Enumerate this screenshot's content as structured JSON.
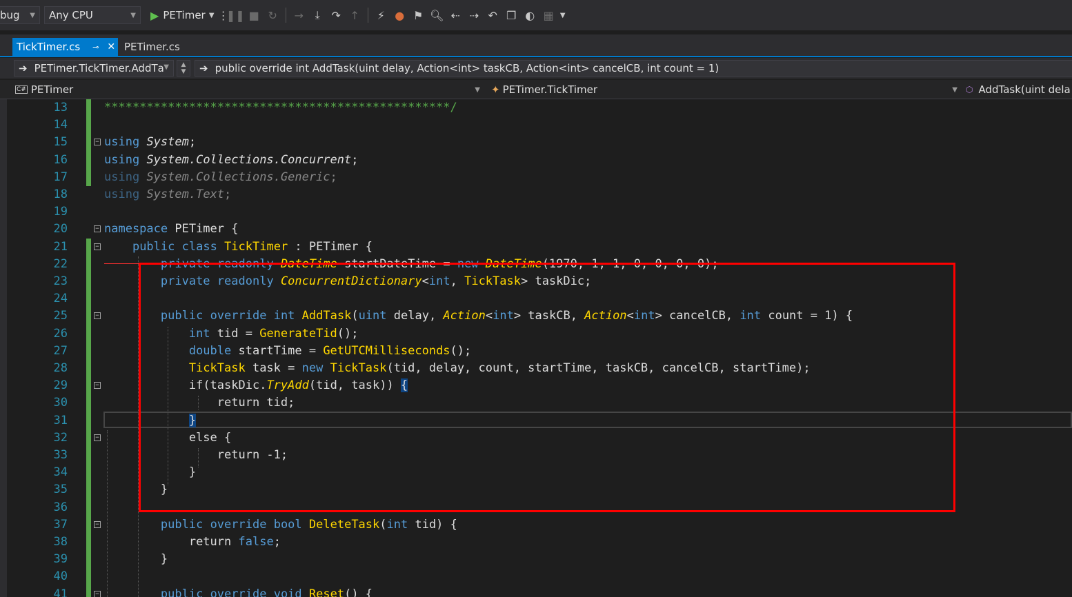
{
  "toolbar": {
    "config": "bug",
    "platform": "Any CPU",
    "start_target": "PETimer"
  },
  "tabs": [
    {
      "label": "TickTimer.cs",
      "active": true
    },
    {
      "label": "PETimer.cs",
      "active": false
    }
  ],
  "nav": {
    "scope": "PETimer.TickTimer.AddTа",
    "member": "public override int AddTask(uint delay, Action<int> taskCB, Action<int> cancelCB, int count = 1)",
    "project": "PETimer",
    "class": "PETimer.TickTimer",
    "method": "AddTask(uint dela"
  },
  "line_numbers": [
    "13",
    "14",
    "15",
    "16",
    "17",
    "18",
    "19",
    "20",
    "21",
    "22",
    "23",
    "24",
    "25",
    "26",
    "27",
    "28",
    "29",
    "30",
    "31",
    "32",
    "33",
    "34",
    "35",
    "36",
    "37",
    "38",
    "39",
    "40",
    "41"
  ],
  "code": {
    "l13": "*************************************************/",
    "l15": [
      "using",
      " ",
      "System",
      ";"
    ],
    "l16": [
      "using",
      " ",
      "System.Collections.Concurrent",
      ";"
    ],
    "l17": [
      "using",
      " ",
      "System.Collections.Generic",
      ";"
    ],
    "l18": [
      "using",
      " ",
      "System.Text",
      ";"
    ],
    "l20": [
      "namespace",
      " PETimer {"
    ],
    "l21": [
      "public",
      " ",
      "class",
      " ",
      "TickTimer",
      " : PETimer {"
    ],
    "l22": [
      "private",
      " ",
      "readonly",
      " ",
      "DateTime",
      " startDateTime = ",
      "new",
      " ",
      "DateTime",
      "(1970, 1, 1, 0, 0, 0, 0);"
    ],
    "l23": [
      "private",
      " ",
      "readonly",
      " ",
      "ConcurrentDictionary",
      "<",
      "int",
      ", ",
      "TickTask",
      "> taskDic;"
    ],
    "l25": [
      "public",
      " ",
      "override",
      " ",
      "int",
      " ",
      "AddTask",
      "(",
      "uint",
      " delay, ",
      "Action",
      "<",
      "int",
      "> taskCB, ",
      "Action",
      "<",
      "int",
      "> cancelCB, ",
      "int",
      " count = 1) {"
    ],
    "l26": [
      "int",
      " tid = ",
      "GenerateTid",
      "();"
    ],
    "l27": [
      "double",
      " startTime = ",
      "GetUTCMilliseconds",
      "();"
    ],
    "l28": [
      "TickTask",
      " task = ",
      "new",
      " ",
      "TickTask",
      "(tid, delay, count, startTime, taskCB, cancelCB, startTime);"
    ],
    "l29": [
      "if",
      "(taskDic.",
      "TryAdd",
      "(tid, task)) ",
      "{"
    ],
    "l30": [
      "return",
      " tid;"
    ],
    "l31": "}",
    "l32": [
      "else",
      " {"
    ],
    "l33": [
      "return",
      " -1;"
    ],
    "l34": "}",
    "l35": "}",
    "l37": [
      "public",
      " ",
      "override",
      " ",
      "bool",
      " ",
      "DeleteTask",
      "(",
      "int",
      " tid) {"
    ],
    "l38": [
      "return",
      " ",
      "false",
      ";"
    ],
    "l39": "}",
    "l41": [
      "public",
      " ",
      "override",
      " ",
      "void",
      " ",
      "Reset",
      "() {"
    ]
  },
  "colors": {
    "highlight_box": "#ff0000",
    "keyword": "#569cd6",
    "type": "#ffd700",
    "line_number": "#2b91af",
    "accent": "#007acc"
  }
}
